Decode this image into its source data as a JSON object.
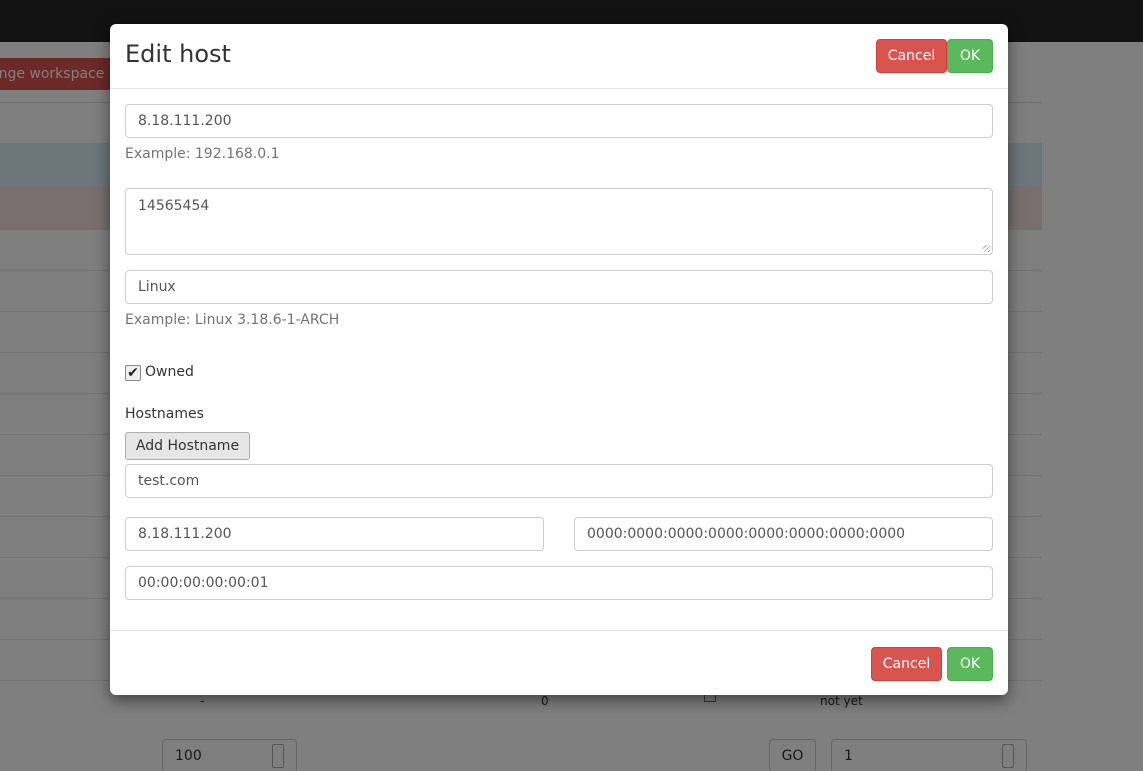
{
  "background": {
    "workspace_button": "ange workspace",
    "last_row": {
      "col1": "-",
      "col2": "0",
      "col4": "not yet"
    },
    "pager": {
      "per_page": "100",
      "go_label": "GO",
      "page": "1"
    }
  },
  "modal": {
    "title": "Edit host",
    "cancel_label": "Cancel",
    "ok_label": "OK",
    "ip": {
      "value": "8.18.111.200",
      "help": "Example: 192.168.0.1"
    },
    "description": {
      "value": "14565454"
    },
    "os": {
      "value": "Linux",
      "help": "Example: Linux 3.18.6-1-ARCH"
    },
    "owned": {
      "label": "Owned",
      "checked": true
    },
    "hostnames": {
      "label": "Hostnames",
      "add_label": "Add Hostname",
      "items": [
        "test.com"
      ]
    },
    "ipv4": {
      "value": "8.18.111.200"
    },
    "ipv6": {
      "value": "0000:0000:0000:0000:0000:0000:0000:0000"
    },
    "mac": {
      "value": "00:00:00:00:00:01"
    },
    "colors": {
      "danger": "#d9534f",
      "success": "#5cb85c"
    }
  }
}
